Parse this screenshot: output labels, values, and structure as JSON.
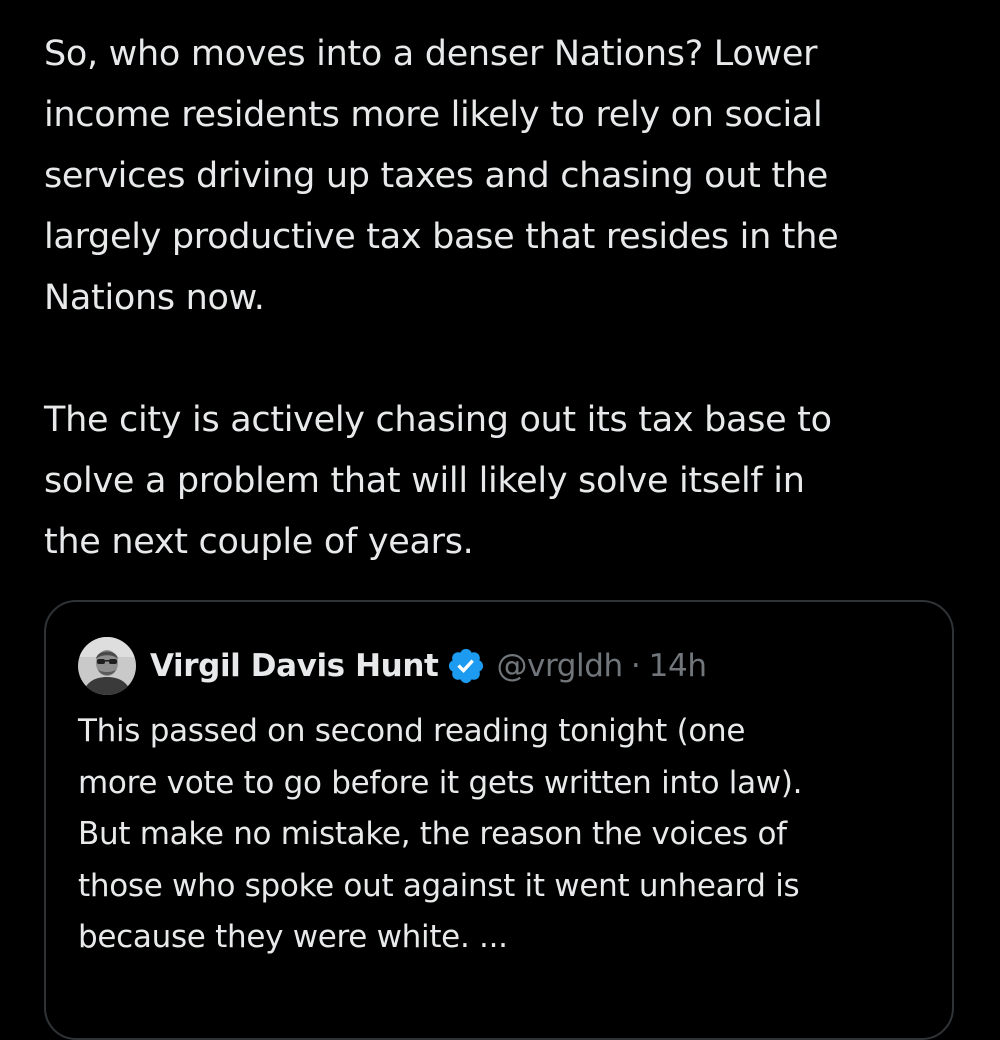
{
  "tweet": {
    "paragraphs": [
      "So, who moves into a denser Nations? Lower\nincome residents more likely to rely on social\nservices driving up taxes and chasing out the\nlargely productive tax base that resides in the\nNations now.",
      "The city is actively chasing out its tax base to\nsolve a problem that will likely solve itself in\nthe next couple of years."
    ]
  },
  "quoted_tweet": {
    "author_name": "Virgil Davis Hunt",
    "author_handle": "@vrgldh",
    "separator": "·",
    "time": "14h",
    "verified_icon": "verified-badge-icon",
    "avatar_icon": "user-avatar",
    "text": "This passed on second reading tonight (one\nmore vote to go before it gets written into law).\nBut make no mistake, the reason the voices of\nthose who spoke out against it went unheard is\nbecause they were white.  ..."
  },
  "colors": {
    "background": "#000000",
    "text_primary": "#e7e9ea",
    "text_secondary": "#71767b",
    "border": "#2f3336",
    "verified_blue": "#1d9bf0"
  }
}
